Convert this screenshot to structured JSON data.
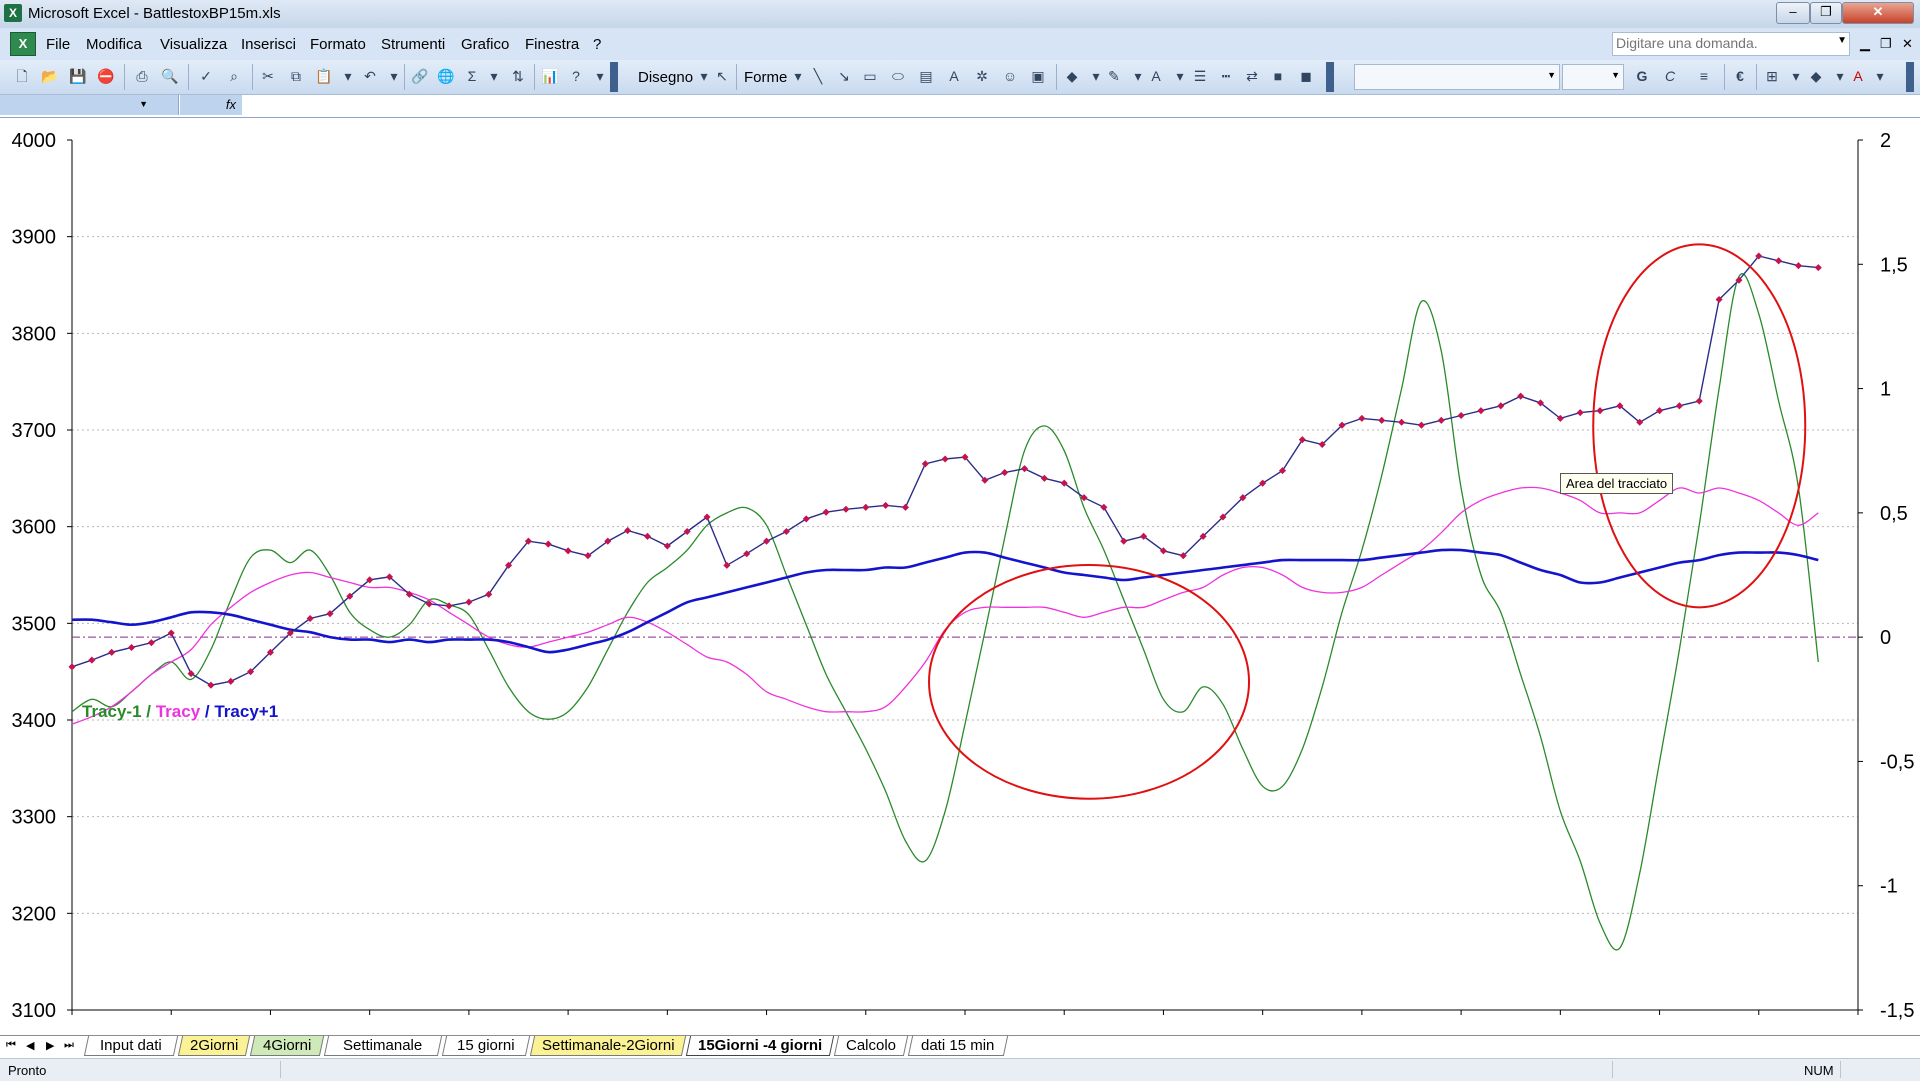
{
  "window": {
    "app_icon": "excel-app-icon",
    "title": "Microsoft Excel - BattlestoxBP15m.xls"
  },
  "menu": {
    "items": [
      "File",
      "Modifica",
      "Visualizza",
      "Inserisci",
      "Formato",
      "Strumenti",
      "Grafico",
      "Finestra",
      "?"
    ],
    "help_placeholder": "Digitare una domanda."
  },
  "toolbar": {
    "drawing_label": "Disegno",
    "shapes_label": "Forme",
    "bold_label": "G",
    "italic_label": "C",
    "euro_label": "€"
  },
  "chart": {
    "legend": {
      "tracy_minus": "Tracy-1",
      "sep1": " / ",
      "tracy": "Tracy",
      "sep2": " / ",
      "tracy_plus": "Tracy+1"
    },
    "tooltip": "Area del tracciato",
    "colors": {
      "price": "#2b2d8a",
      "price_marker": "#c3144e",
      "tracy_minus": "#2a8a2a",
      "tracy": "#ee33dd",
      "tracy_plus": "#1414cc",
      "zero_line": "#8a2a8a",
      "highlight": "#e01010"
    }
  },
  "chart_data": {
    "type": "line",
    "left_axis": {
      "ylim": [
        3100,
        4000
      ],
      "ticks": [
        "4000",
        "3900",
        "3800",
        "3700",
        "3600",
        "3500",
        "3400",
        "3300",
        "3200",
        "3100"
      ]
    },
    "right_axis": {
      "ylim": [
        -1.5,
        2
      ],
      "ticks": [
        "2",
        "1,5",
        "1",
        "0,5",
        "0",
        "-0,5",
        "-1",
        "-1,5"
      ]
    },
    "grid": "horizontal dashed",
    "x": [
      0,
      20,
      40,
      60,
      80,
      100,
      120,
      140,
      160,
      180,
      200,
      220,
      240,
      260,
      280,
      300,
      320,
      340,
      360,
      380,
      400,
      420,
      440,
      460,
      480,
      500,
      520,
      540,
      560,
      580,
      600,
      620,
      640,
      660,
      680,
      700,
      720,
      740,
      760,
      780,
      800,
      820,
      840,
      860,
      880,
      900,
      920,
      940,
      960,
      980,
      1000,
      1020,
      1040,
      1060,
      1080,
      1100,
      1120,
      1140,
      1160,
      1180,
      1200,
      1220,
      1240,
      1260,
      1280,
      1300,
      1320,
      1340,
      1360,
      1380,
      1400,
      1420,
      1440,
      1460,
      1480,
      1500,
      1520,
      1540,
      1560,
      1580,
      1600,
      1620,
      1640,
      1660,
      1680,
      1700,
      1720,
      1740,
      1760
    ],
    "series": [
      {
        "axis": "left",
        "values": [
          3455,
          3462,
          3470,
          3475,
          3480,
          3490,
          3448,
          3436,
          3440,
          3450,
          3470,
          3490,
          3505,
          3510,
          3528,
          3545,
          3548,
          3530,
          3520,
          3518,
          3522,
          3530,
          3560,
          3585,
          3582,
          3575,
          3570,
          3585,
          3596,
          3590,
          3580,
          3595,
          3610,
          3560,
          3572,
          3585,
          3595,
          3608,
          3615,
          3618,
          3620,
          3622,
          3620,
          3665,
          3670,
          3672,
          3648,
          3656,
          3660,
          3650,
          3645,
          3630,
          3620,
          3585,
          3590,
          3575,
          3570,
          3590,
          3610,
          3630,
          3645,
          3658,
          3690,
          3685,
          3705,
          3712,
          3710,
          3708,
          3705,
          3710,
          3715,
          3720,
          3725,
          3735,
          3728,
          3712,
          3718,
          3720,
          3725,
          3708,
          3720,
          3725,
          3730,
          3835,
          3855,
          3880,
          3875,
          3870,
          3868
        ]
      },
      {
        "name": "Tracy-1",
        "axis": "right",
        "values": [
          -0.3,
          -0.25,
          -0.28,
          -0.22,
          -0.15,
          -0.1,
          -0.17,
          -0.05,
          0.15,
          0.32,
          0.35,
          0.3,
          0.35,
          0.25,
          0.1,
          0.03,
          0,
          0.05,
          0.15,
          0.13,
          0.09,
          -0.05,
          -0.2,
          -0.3,
          -0.33,
          -0.3,
          -0.2,
          -0.05,
          0.1,
          0.22,
          0.28,
          0.35,
          0.45,
          0.5,
          0.52,
          0.45,
          0.25,
          0.05,
          -0.15,
          -0.3,
          -0.45,
          -0.62,
          -0.82,
          -0.9,
          -0.7,
          -0.35,
          0.02,
          0.4,
          0.75,
          0.85,
          0.75,
          0.52,
          0.35,
          0.15,
          -0.05,
          -0.25,
          -0.3,
          -0.2,
          -0.27,
          -0.45,
          -0.6,
          -0.6,
          -0.45,
          -0.2,
          0.1,
          0.35,
          0.65,
          1.0,
          1.35,
          1.15,
          0.6,
          0.25,
          0.1,
          -0.15,
          -0.4,
          -0.7,
          -0.9,
          -1.15,
          -1.25,
          -0.95,
          -0.5,
          -0.05,
          0.45,
          1.0,
          1.45,
          1.3,
          0.95,
          0.6,
          -0.1
        ]
      },
      {
        "name": "Tracy",
        "axis": "right",
        "values": [
          -0.35,
          -0.32,
          -0.28,
          -0.22,
          -0.15,
          -0.1,
          -0.05,
          0.05,
          0.12,
          0.18,
          0.22,
          0.25,
          0.26,
          0.24,
          0.22,
          0.2,
          0.2,
          0.18,
          0.15,
          0.1,
          0.05,
          0.0,
          -0.03,
          -0.04,
          -0.02,
          0.0,
          0.02,
          0.05,
          0.08,
          0.06,
          0.02,
          -0.03,
          -0.08,
          -0.1,
          -0.15,
          -0.22,
          -0.25,
          -0.28,
          -0.3,
          -0.3,
          -0.3,
          -0.28,
          -0.2,
          -0.1,
          0.03,
          0.1,
          0.12,
          0.12,
          0.12,
          0.12,
          0.1,
          0.08,
          0.1,
          0.12,
          0.12,
          0.15,
          0.18,
          0.2,
          0.25,
          0.28,
          0.28,
          0.25,
          0.2,
          0.18,
          0.18,
          0.2,
          0.25,
          0.3,
          0.35,
          0.42,
          0.5,
          0.55,
          0.58,
          0.6,
          0.6,
          0.58,
          0.55,
          0.5,
          0.5,
          0.5,
          0.55,
          0.6,
          0.58,
          0.6,
          0.58,
          0.55,
          0.5,
          0.45,
          0.5
        ]
      },
      {
        "name": "Tracy+1",
        "axis": "right",
        "values": [
          0.07,
          0.07,
          0.06,
          0.05,
          0.06,
          0.08,
          0.1,
          0.1,
          0.09,
          0.07,
          0.05,
          0.03,
          0.02,
          0.0,
          -0.01,
          -0.01,
          -0.02,
          -0.01,
          -0.02,
          -0.01,
          -0.01,
          -0.01,
          -0.02,
          -0.04,
          -0.06,
          -0.05,
          -0.03,
          -0.01,
          0.02,
          0.06,
          0.1,
          0.14,
          0.16,
          0.18,
          0.2,
          0.22,
          0.24,
          0.26,
          0.27,
          0.27,
          0.27,
          0.28,
          0.28,
          0.3,
          0.32,
          0.34,
          0.34,
          0.32,
          0.3,
          0.28,
          0.26,
          0.25,
          0.24,
          0.23,
          0.24,
          0.25,
          0.26,
          0.27,
          0.28,
          0.29,
          0.3,
          0.31,
          0.31,
          0.31,
          0.31,
          0.31,
          0.32,
          0.33,
          0.34,
          0.35,
          0.35,
          0.34,
          0.33,
          0.3,
          0.27,
          0.25,
          0.22,
          0.22,
          0.24,
          0.26,
          0.28,
          0.3,
          0.31,
          0.33,
          0.34,
          0.34,
          0.34,
          0.33,
          0.31
        ]
      }
    ],
    "reference_line": {
      "axis": "right",
      "y": 0
    },
    "highlights": [
      {
        "cx": 1025,
        "cy_right": -0.18,
        "rx": 160,
        "ry": 0.47
      },
      {
        "cx": 1640,
        "cy_right": 0.85,
        "rx": 106,
        "ry": 0.73
      }
    ]
  },
  "sheets": {
    "nav": [
      "⏮",
      "◀",
      "▶",
      "⏭"
    ],
    "tabs": [
      {
        "label": "Input dati",
        "style": "plain"
      },
      {
        "label": "2Giorni",
        "style": "yellow"
      },
      {
        "label": "4Giorni",
        "style": "green"
      },
      {
        "label": "Settimanale",
        "style": "plain"
      },
      {
        "label": "15 giorni",
        "style": "plain"
      },
      {
        "label": "Settimanale-2Giorni",
        "style": "yellow"
      },
      {
        "label": "15Giorni -4 giorni",
        "style": "active"
      },
      {
        "label": "Calcolo",
        "style": "plain"
      },
      {
        "label": "dati 15 min",
        "style": "plain"
      }
    ]
  },
  "status": {
    "left": "Pronto",
    "num": "NUM"
  }
}
